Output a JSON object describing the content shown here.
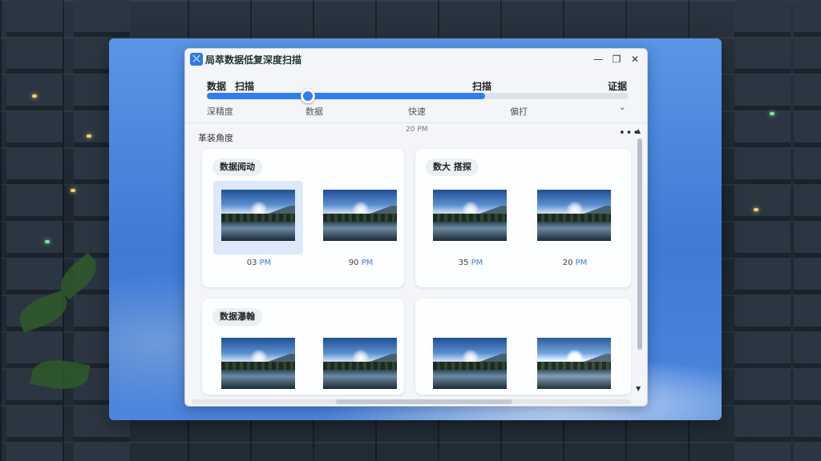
{
  "window": {
    "title": "局萃数据低复深度扫描",
    "minimize_glyph": "—",
    "maximize_glyph": "❐",
    "close_glyph": "✕"
  },
  "steps": {
    "labels": [
      "数据",
      "扫描",
      "扫描",
      "证据"
    ],
    "sub_labels": [
      "深精度",
      "数据",
      "快速",
      "偏打"
    ],
    "progress": 0.66,
    "knob_position": 0.24
  },
  "ruler_label": "20 PM",
  "section_title": "革装角度",
  "cards": [
    {
      "title": "数据阅动",
      "thumbs": [
        {
          "value": "03",
          "unit": "PM",
          "selected": true
        },
        {
          "value": "90",
          "unit": "PM",
          "selected": false
        }
      ]
    },
    {
      "title": "数大 搭探",
      "thumbs": [
        {
          "value": "35",
          "unit": "PM",
          "selected": false
        },
        {
          "value": "20",
          "unit": "PM",
          "selected": false
        }
      ]
    },
    {
      "title": "数据瀑翰",
      "thumbs": [
        {
          "value": "",
          "unit": "",
          "selected": false
        },
        {
          "value": "",
          "unit": "",
          "selected": false
        }
      ]
    },
    {
      "title": "",
      "thumbs": [
        {
          "value": "",
          "unit": "",
          "selected": false
        },
        {
          "value": "",
          "unit": "",
          "selected": false
        }
      ]
    }
  ],
  "icons": {
    "app": "app-logo-icon",
    "more": "more-horizontal-icon",
    "expand": "chevron-down-icon",
    "scroll_up": "scroll-up-icon",
    "scroll_down": "scroll-down-icon"
  },
  "colors": {
    "accent": "#2f7df0",
    "frame": "#3e7ad6"
  }
}
